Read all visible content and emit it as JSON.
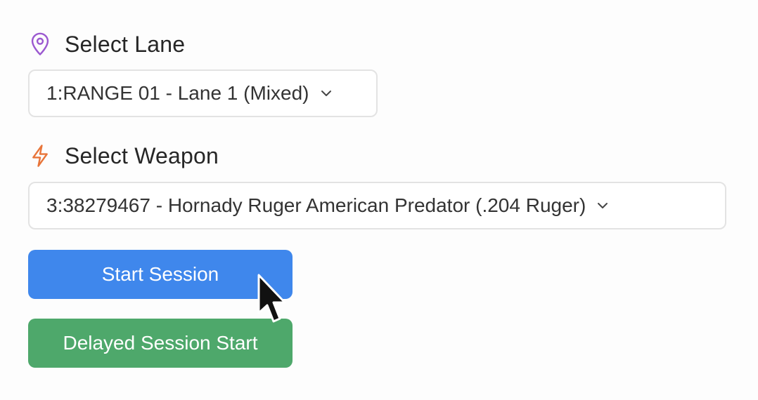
{
  "lane": {
    "label": "Select Lane",
    "icon": "map-pin-icon",
    "icon_color": "#9b59d0",
    "selected": "1:RANGE 01 - Lane 1 (Mixed)"
  },
  "weapon": {
    "label": "Select Weapon",
    "icon": "lightning-icon",
    "icon_color": "#e8753a",
    "selected": "3:38279467 - Hornady Ruger American Predator (.204 Ruger)"
  },
  "buttons": {
    "start_session": "Start Session",
    "start_session_color": "#3f87ec",
    "delayed_session_start": "Delayed Session Start",
    "delayed_session_start_color": "#4ea86b"
  }
}
